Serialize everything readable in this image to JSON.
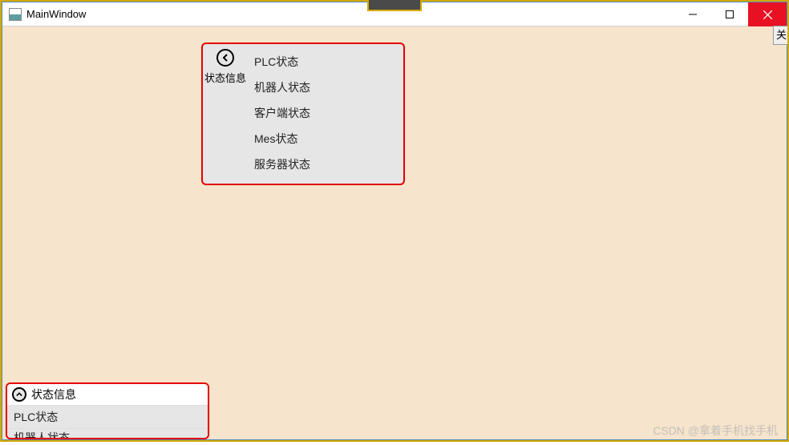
{
  "window": {
    "title": "MainWindow"
  },
  "offscreen_button": {
    "visible_text": "关"
  },
  "status_panel_top": {
    "header": "状态信息",
    "items": [
      "PLC状态",
      "机器人状态",
      "客户端状态",
      "Mes状态",
      "服务器状态"
    ]
  },
  "status_panel_bottom": {
    "header": "状态信息",
    "items": [
      "PLC状态",
      "机器人状态"
    ]
  },
  "watermark": "CSDN @拿着手机找手机"
}
